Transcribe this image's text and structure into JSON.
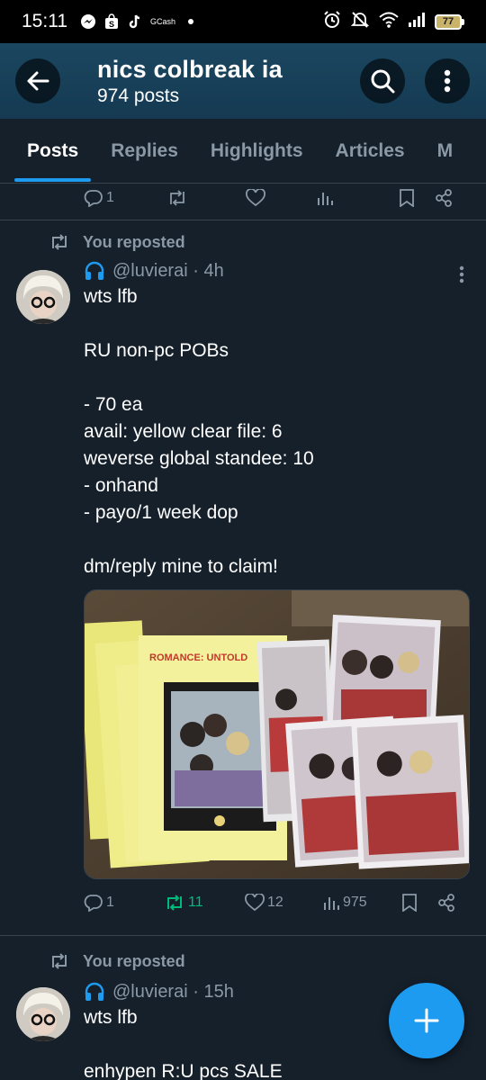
{
  "status_bar": {
    "time": "15:11",
    "notification_icons": [
      "messenger-icon",
      "shopee-icon",
      "tiktok-icon",
      "gcash-icon"
    ],
    "gcash_label": "GCash",
    "battery_level": "77"
  },
  "header": {
    "title": "nics colbreak ia",
    "subtitle": "974 posts"
  },
  "tabs": [
    {
      "label": "Posts",
      "active": true
    },
    {
      "label": "Replies",
      "active": false
    },
    {
      "label": "Highlights",
      "active": false
    },
    {
      "label": "Articles",
      "active": false
    },
    {
      "label": "M",
      "active": false
    }
  ],
  "top_actions": {
    "reply_count": "1"
  },
  "posts": [
    {
      "repost_label": "You reposted",
      "handle": "@luvierai",
      "time": "4h",
      "text": "wts lfb\n\nRU non-pc POBs\n\n- 70 ea\navail: yellow clear file: 6\nweverse global standee: 10\n- onhand\n- payo/1 week dop\n\ndm/reply mine to claim!",
      "reply_count": "1",
      "repost_count": "11",
      "like_count": "12",
      "view_count": "975",
      "media_text": "ROMANCE: UNTOLD"
    },
    {
      "repost_label": "You reposted",
      "handle": "@luvierai",
      "time": "15h",
      "text": "wts lfb\n\nenhypen R:U pcs SALE"
    }
  ],
  "colors": {
    "background": "#15202b",
    "accent": "#1d9bf0",
    "repost_green": "#00ba7c",
    "muted": "#8b98a5",
    "header": "#1b4660"
  }
}
